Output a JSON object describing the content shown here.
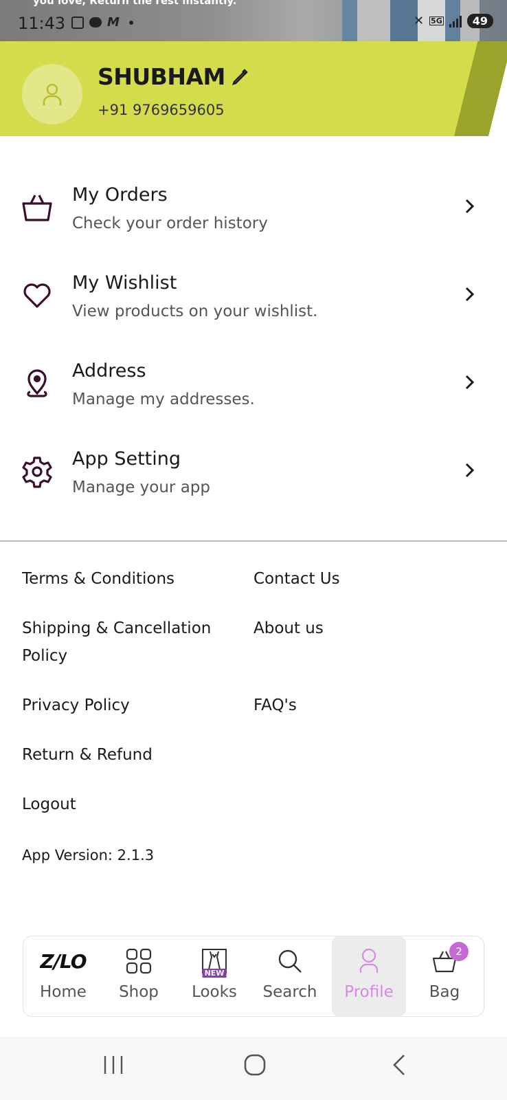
{
  "status_bar": {
    "banner_text": "you love, Return the rest instantly.",
    "time": "11:43",
    "network": "5G",
    "battery": "49"
  },
  "profile": {
    "name": "SHUBHAM",
    "phone": "+91 9769659605"
  },
  "menu": [
    {
      "title": "My Orders",
      "subtitle": "Check your order history",
      "icon": "bag-icon"
    },
    {
      "title": "My Wishlist",
      "subtitle": "View products on your wishlist.",
      "icon": "heart-icon"
    },
    {
      "title": "Address",
      "subtitle": "Manage my addresses.",
      "icon": "location-pin-icon"
    },
    {
      "title": "App Setting",
      "subtitle": "Manage your app",
      "icon": "gear-icon"
    }
  ],
  "links": {
    "terms": "Terms & Conditions",
    "contact": "Contact Us",
    "shipping_line1": "Shipping & Cancellation",
    "shipping_line2": "Policy",
    "about": "About us",
    "privacy": "Privacy Policy",
    "faq": "FAQ's",
    "return_refund": "Return & Refund",
    "logout": "Logout"
  },
  "app_version": "App Version: 2.1.3",
  "bottom_nav": {
    "logo": "Z/LO",
    "home": "Home",
    "shop": "Shop",
    "looks": "Looks",
    "looks_badge": "NEW",
    "search": "Search",
    "profile": "Profile",
    "bag": "Bag",
    "bag_count": "2",
    "active": "Profile"
  },
  "colors": {
    "header_bg": "#d4dc4b",
    "icon_color": "#3a0f2a",
    "active_tab": "#d58be0",
    "badge": "#c86ad6"
  }
}
